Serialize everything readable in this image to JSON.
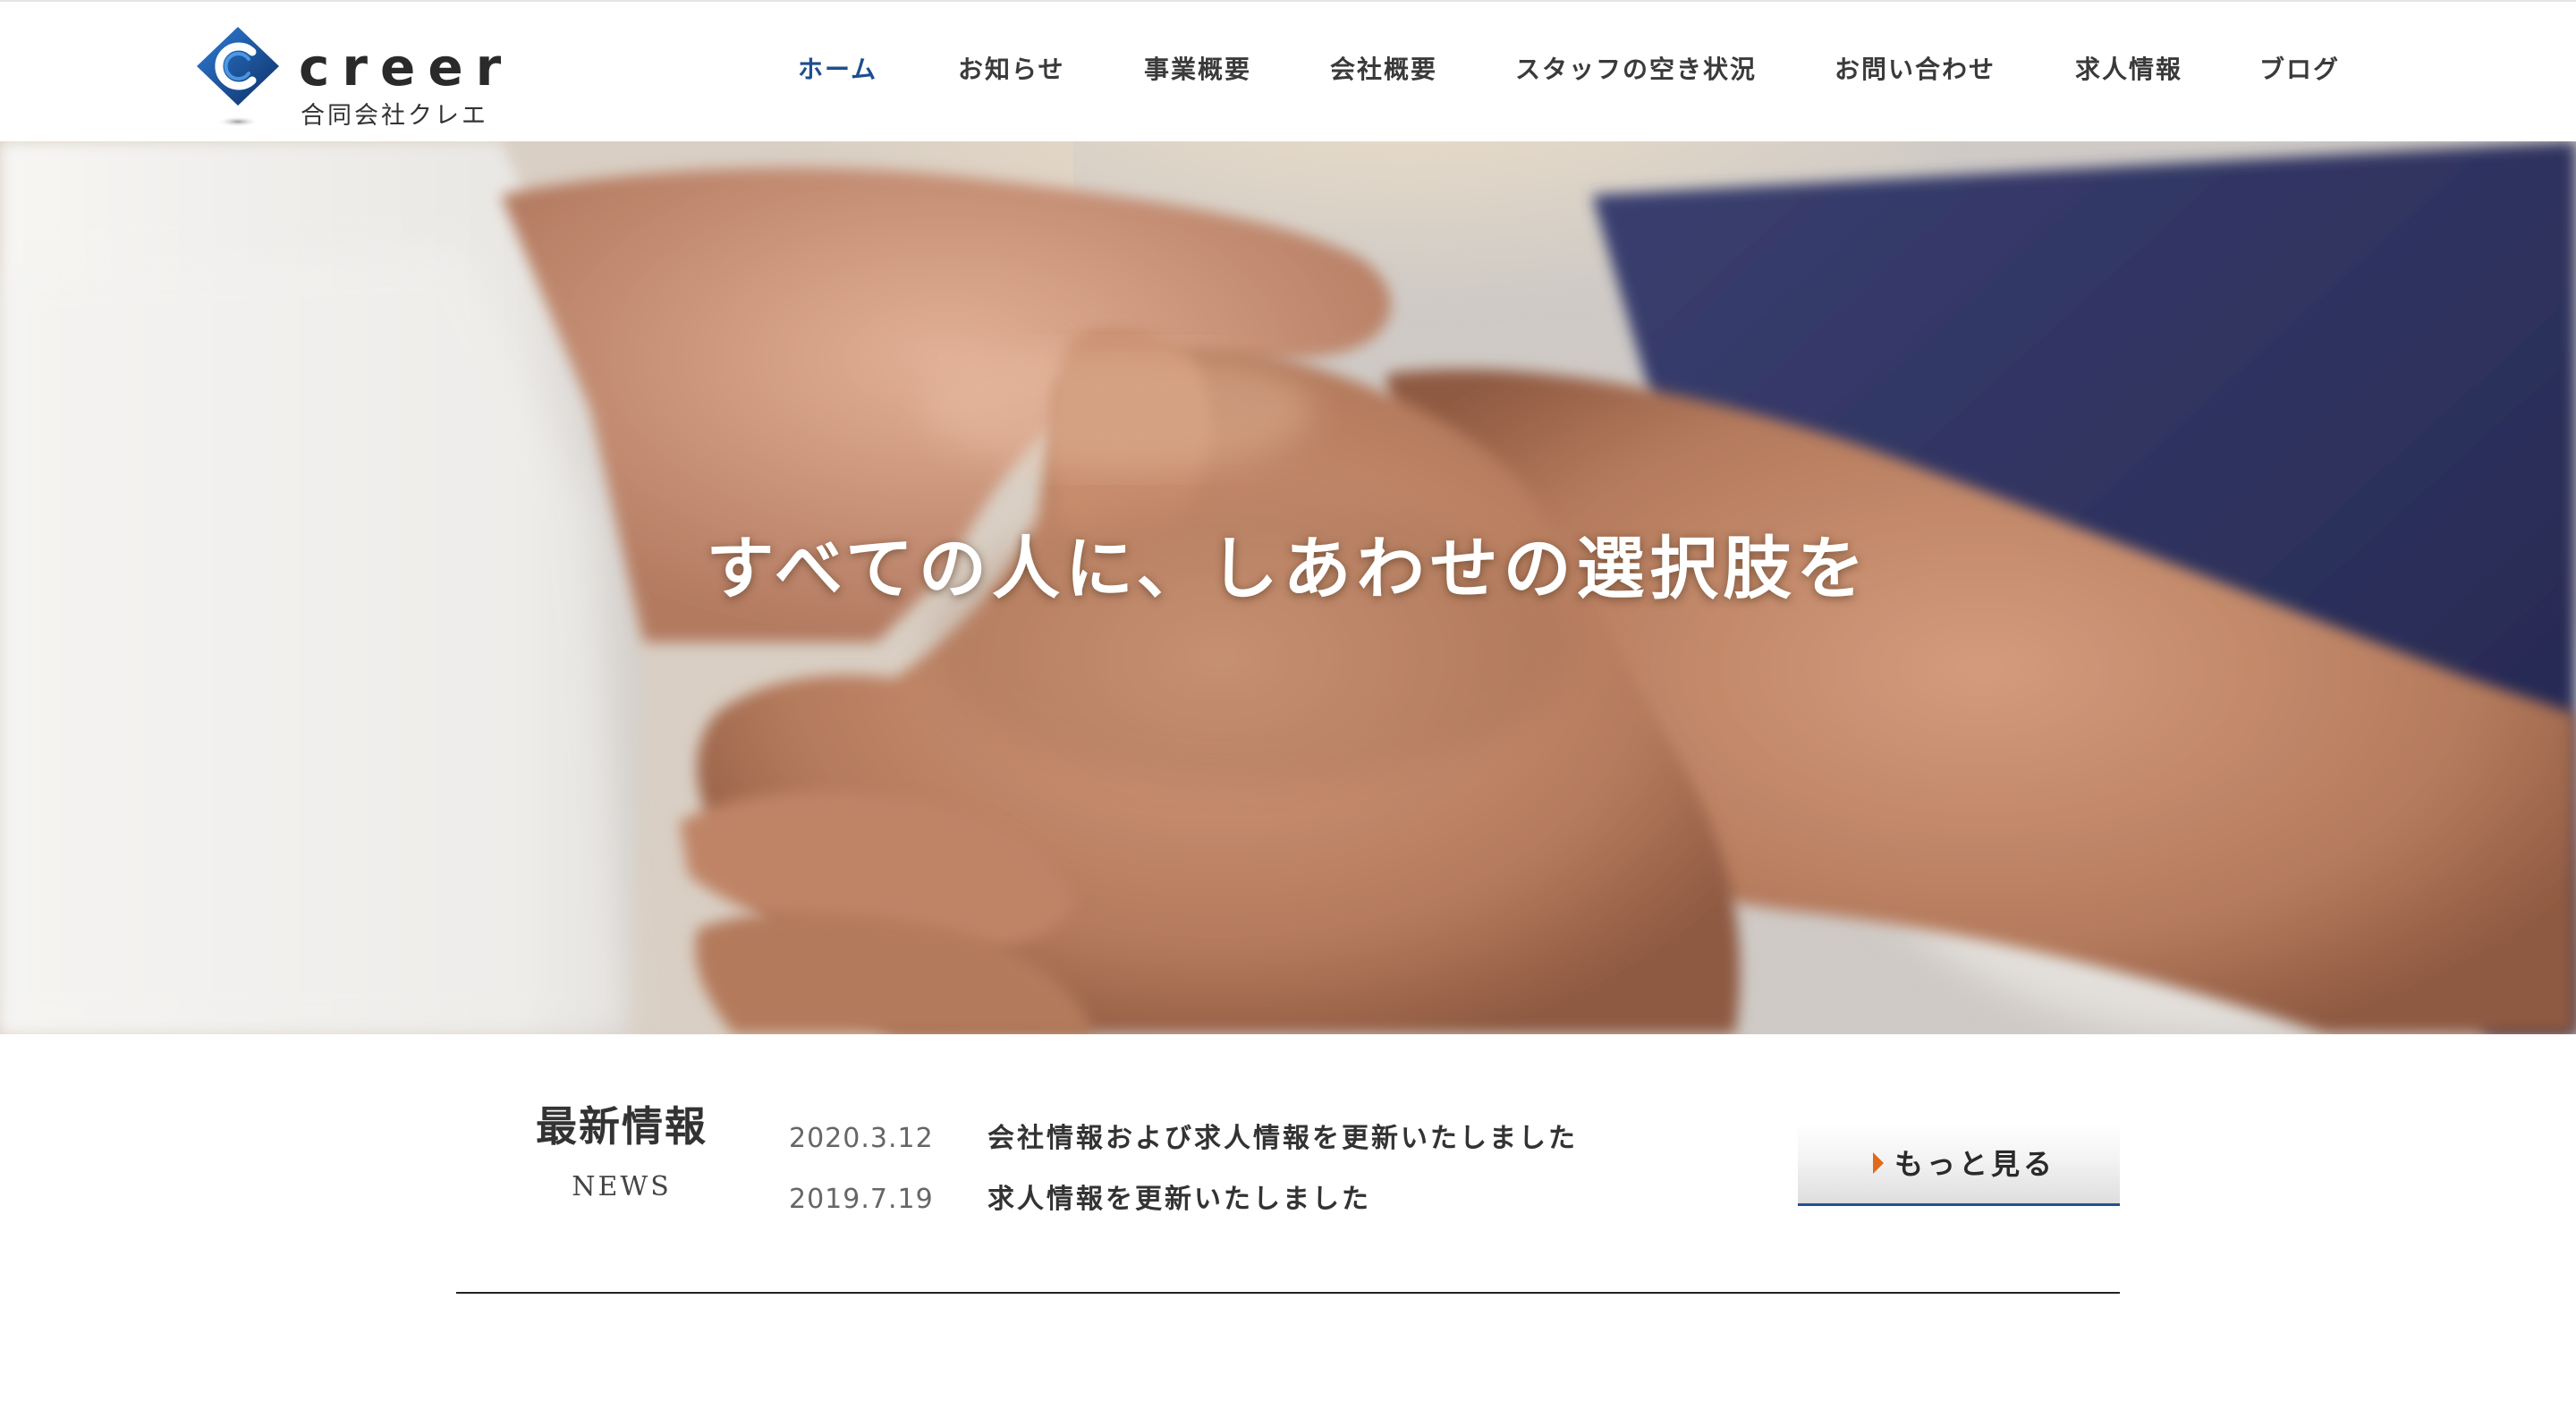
{
  "brand": {
    "wordmark": "creer",
    "company": "合同会社クレエ",
    "accent_color": "#1d4e8f",
    "logo_icon": "diamond-c-logo-icon"
  },
  "nav": {
    "items": [
      {
        "label": "ホーム",
        "active": true
      },
      {
        "label": "お知らせ",
        "active": false
      },
      {
        "label": "事業概要",
        "active": false
      },
      {
        "label": "会社概要",
        "active": false
      },
      {
        "label": "スタッフの空き状況",
        "active": false
      },
      {
        "label": "お問い合わせ",
        "active": false
      },
      {
        "label": "求人情報",
        "active": false
      },
      {
        "label": "ブログ",
        "active": false
      }
    ]
  },
  "hero": {
    "tagline": "すべての人に、しあわせの選択肢を",
    "image": "clasped-hands-photo"
  },
  "news": {
    "title": "最新情報",
    "subtitle": "NEWS",
    "items": [
      {
        "date": "2020.3.12",
        "text": "会社情報および求人情報を更新いたしました"
      },
      {
        "date": "2019.7.19",
        "text": "求人情報を更新いたしました"
      }
    ],
    "more_label": "もっと見る",
    "more_icon": "triangle-right-icon",
    "more_icon_color": "#e06a1c"
  }
}
